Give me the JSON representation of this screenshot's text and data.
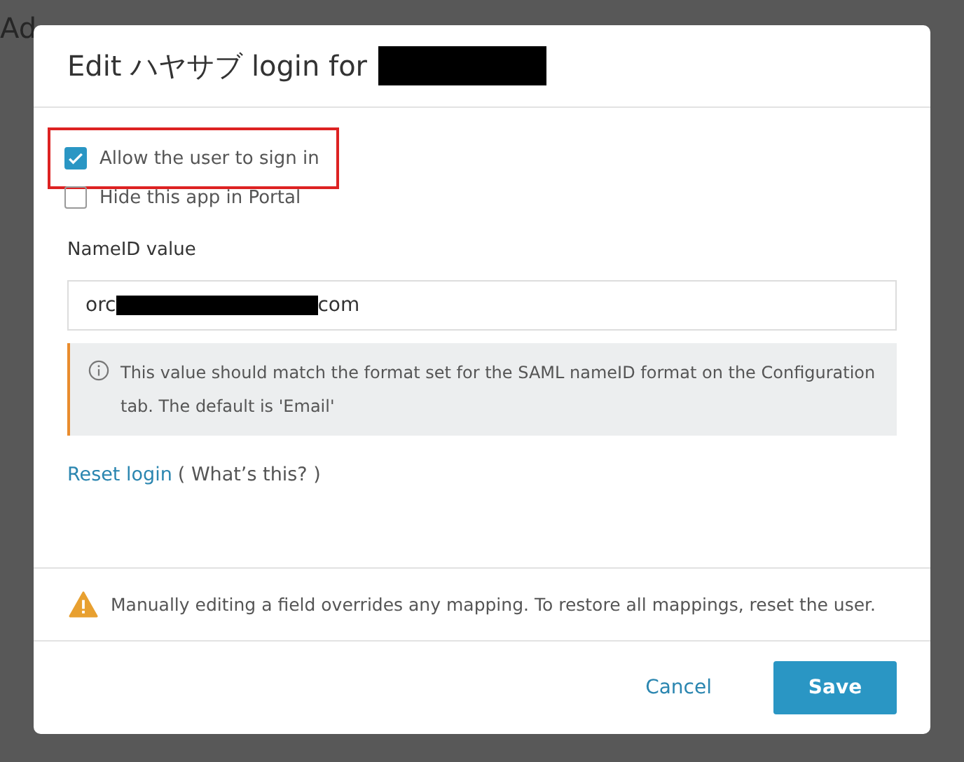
{
  "background": {
    "text": "Ad"
  },
  "dialog": {
    "title": "Edit ハヤサブ login for",
    "checkboxes": [
      {
        "label": "Allow the user to sign in",
        "checked": true,
        "highlighted": true
      },
      {
        "label": "Hide this app in Portal",
        "checked": false,
        "highlighted": false
      }
    ],
    "nameid": {
      "label": "NameID value",
      "value_start": "orc",
      "value_end": "com"
    },
    "info": "This value should match the format set for the SAML nameID format on the Configuration tab. The default is 'Email'",
    "reset_link": "Reset login",
    "whats_this": "( What’s this? )",
    "warning": "Manually editing a field overrides any mapping. To restore all mappings, reset the user.",
    "buttons": [
      {
        "label": "Cancel",
        "kind": "secondary"
      },
      {
        "label": "Save",
        "kind": "primary"
      }
    ]
  }
}
